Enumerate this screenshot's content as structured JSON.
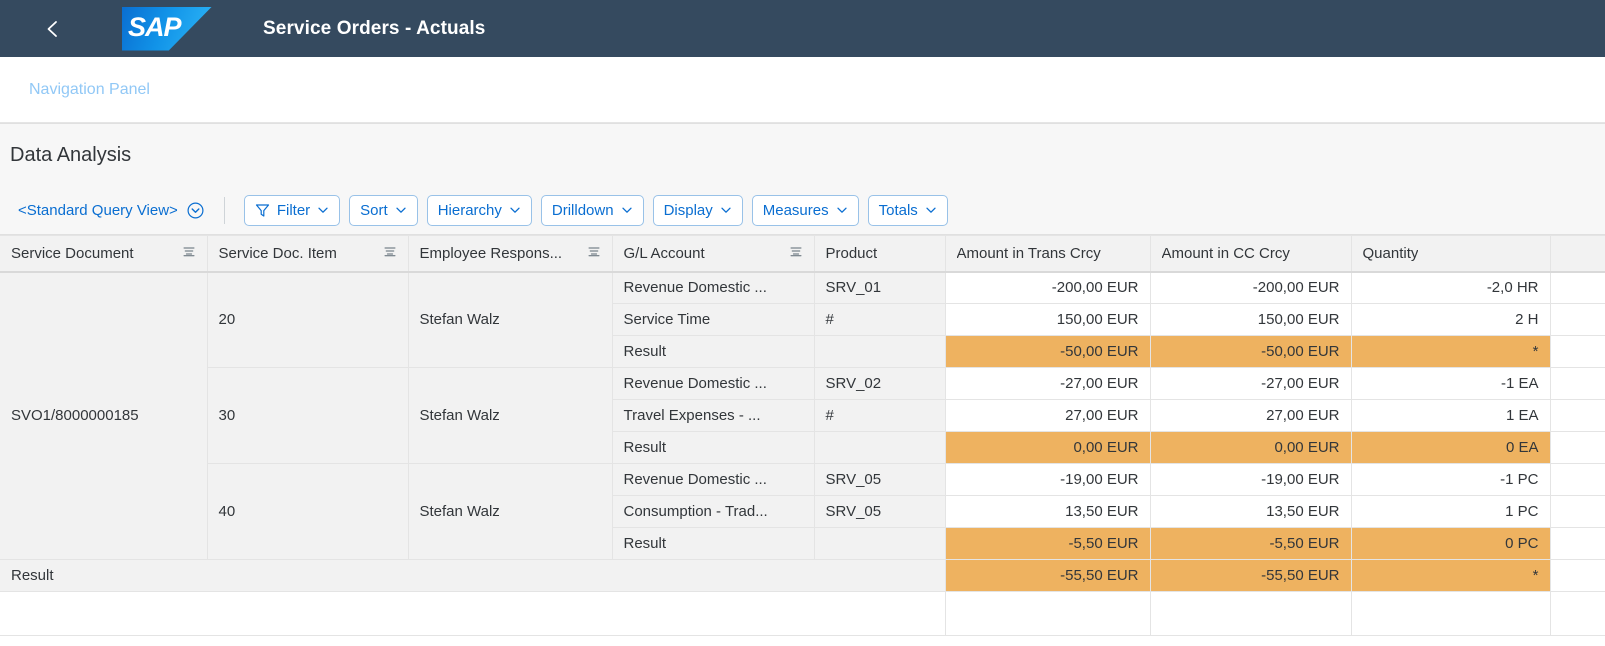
{
  "shell": {
    "back_icon": "chevron-left-icon",
    "logo_text": "SAP",
    "title": "Service Orders - Actuals"
  },
  "nav_panel": {
    "label": "Navigation Panel"
  },
  "section": {
    "title": "Data Analysis"
  },
  "toolbar": {
    "query_view_label": "<Standard Query View>",
    "query_view_icon": "chevron-down-circle-icon",
    "buttons": [
      {
        "label": "Filter",
        "icon": "filter-icon"
      },
      {
        "label": "Sort",
        "icon": ""
      },
      {
        "label": "Hierarchy",
        "icon": ""
      },
      {
        "label": "Drilldown",
        "icon": ""
      },
      {
        "label": "Display",
        "icon": ""
      },
      {
        "label": "Measures",
        "icon": ""
      },
      {
        "label": "Totals",
        "icon": ""
      }
    ]
  },
  "table": {
    "columns": [
      {
        "label": "Service Document",
        "menu": true,
        "align": "left"
      },
      {
        "label": "Service Doc. Item",
        "menu": true,
        "align": "left"
      },
      {
        "label": "Employee Respons...",
        "menu": true,
        "align": "left"
      },
      {
        "label": "G/L Account",
        "menu": true,
        "align": "left"
      },
      {
        "label": "Product",
        "menu": true,
        "align": "left"
      },
      {
        "label": "Amount in Trans Crcy",
        "menu": false,
        "align": "left"
      },
      {
        "label": "Amount in CC Crcy",
        "menu": false,
        "align": "left"
      },
      {
        "label": "Quantity",
        "menu": false,
        "align": "left"
      }
    ],
    "service_document": "SVO1/8000000185",
    "groups": [
      {
        "item": "20",
        "employee": "Stefan Walz",
        "rows": [
          {
            "gl": "Revenue Domestic ...",
            "product": "SRV_01",
            "trans": "-200,00 EUR",
            "cc": "-200,00 EUR",
            "qty": "-2,0 HR"
          },
          {
            "gl": "Service Time",
            "product": "#",
            "trans": "150,00 EUR",
            "cc": "150,00 EUR",
            "qty": "2 H"
          }
        ],
        "result": {
          "gl": "Result",
          "product": "",
          "trans": "-50,00 EUR",
          "cc": "-50,00 EUR",
          "qty": "*"
        }
      },
      {
        "item": "30",
        "employee": "Stefan Walz",
        "rows": [
          {
            "gl": "Revenue Domestic ...",
            "product": "SRV_02",
            "trans": "-27,00 EUR",
            "cc": "-27,00 EUR",
            "qty": "-1 EA"
          },
          {
            "gl": "Travel Expenses - ...",
            "product": "#",
            "trans": "27,00 EUR",
            "cc": "27,00 EUR",
            "qty": "1 EA"
          }
        ],
        "result": {
          "gl": "Result",
          "product": "",
          "trans": "0,00 EUR",
          "cc": "0,00 EUR",
          "qty": "0 EA"
        }
      },
      {
        "item": "40",
        "employee": "Stefan Walz",
        "rows": [
          {
            "gl": "Revenue Domestic ...",
            "product": "SRV_05",
            "trans": "-19,00 EUR",
            "cc": "-19,00 EUR",
            "qty": "-1 PC"
          },
          {
            "gl": "Consumption - Trad...",
            "product": "SRV_05",
            "trans": "13,50 EUR",
            "cc": "13,50 EUR",
            "qty": "1 PC"
          }
        ],
        "result": {
          "gl": "Result",
          "product": "",
          "trans": "-5,50 EUR",
          "cc": "-5,50 EUR",
          "qty": "0 PC"
        }
      }
    ],
    "grand_total": {
      "label": "Result",
      "trans": "-55,50 EUR",
      "cc": "-55,50 EUR",
      "qty": "*"
    }
  },
  "colors": {
    "shell_bg": "#354a5f",
    "accent": "#0a6ed1",
    "result_highlight": "#eeb260",
    "nav_link": "#91c8f6"
  }
}
